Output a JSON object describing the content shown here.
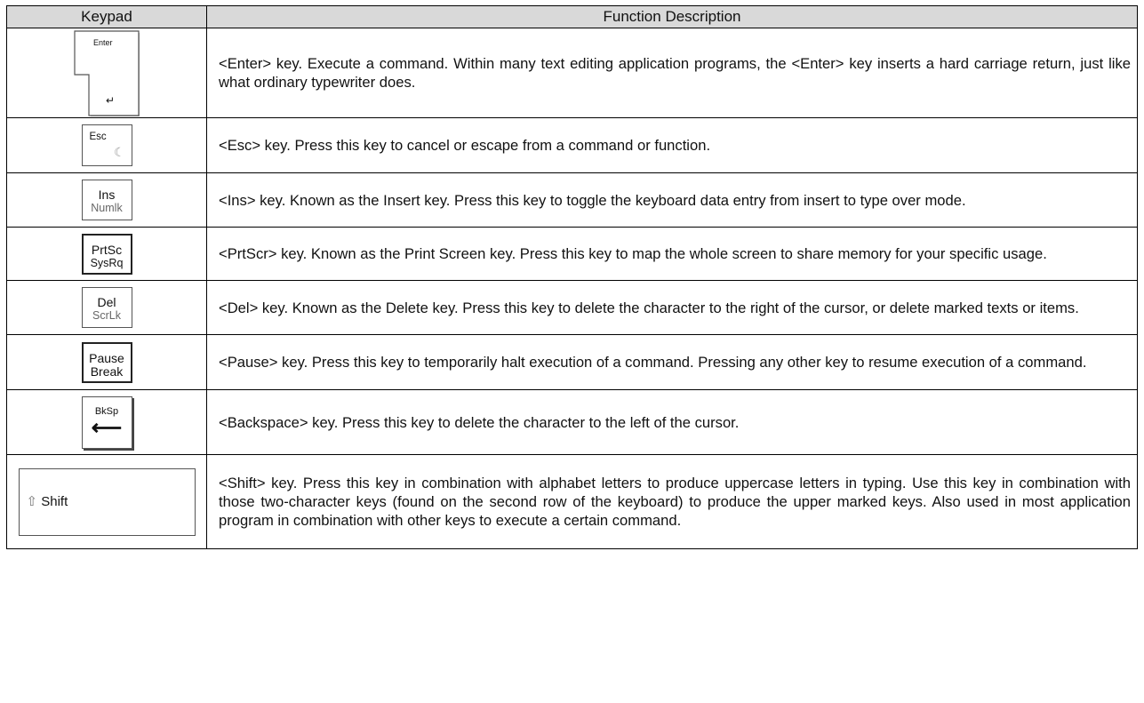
{
  "table": {
    "headers": [
      "Keypad",
      "Function Description"
    ],
    "rows": [
      {
        "key": {
          "label": "Enter",
          "icon": "return-arrow-icon"
        },
        "description": "<Enter> key. Execute a command. Within many text editing application programs, the <Enter> key inserts a hard carriage return, just like what ordinary typewriter does."
      },
      {
        "key": {
          "label": "Esc",
          "icon": "sleep-moon-icon"
        },
        "description": "<Esc> key. Press this key to cancel or escape from a command or function."
      },
      {
        "key": {
          "label": "Ins",
          "sublabel": "Numlk"
        },
        "description": "<Ins> key. Known as the Insert key. Press this key to toggle the keyboard data entry from insert to type over mode."
      },
      {
        "key": {
          "label": "PrtSc",
          "sublabel": "SysRq"
        },
        "description": "<PrtScr> key. Known as the Print Screen key. Press this key to map the whole screen to share memory for your specific usage."
      },
      {
        "key": {
          "label": "Del",
          "sublabel": "ScrLk"
        },
        "description": "<Del> key. Known as the Delete key. Press this key to delete the character to the right of the cursor, or delete marked texts or items."
      },
      {
        "key": {
          "label": "Pause",
          "sublabel": "Break"
        },
        "description": "<Pause> key. Press this key to temporarily halt execution of a command. Pressing any other key to resume execution of a command."
      },
      {
        "key": {
          "label": "BkSp",
          "icon": "left-arrow-icon"
        },
        "description": "<Backspace> key. Press this key to delete the character to the left of the cursor."
      },
      {
        "key": {
          "label": "Shift",
          "icon": "shift-arrow-icon"
        },
        "description": "<Shift> key. Press this key in combination with alphabet letters to produce uppercase letters in typing. Use this key in combination with those two-character keys (found on the second row of the keyboard) to produce the upper marked keys. Also used in most application program in combination with other keys to execute a certain command."
      }
    ]
  }
}
